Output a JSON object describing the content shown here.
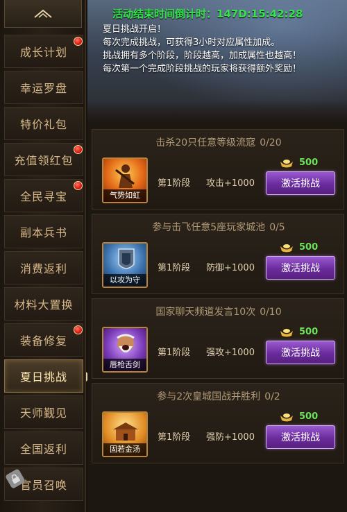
{
  "sidebar": {
    "items": [
      {
        "label": "成长计划",
        "badge": true
      },
      {
        "label": "幸运罗盘",
        "badge": false
      },
      {
        "label": "特价礼包",
        "badge": false
      },
      {
        "label": "充值领红包",
        "badge": true
      },
      {
        "label": "全民寻宝",
        "badge": true
      },
      {
        "label": "副本兵书",
        "badge": false
      },
      {
        "label": "消费返利",
        "badge": false
      },
      {
        "label": "材料大置换",
        "badge": false
      },
      {
        "label": "装备修复",
        "badge": true
      },
      {
        "label": "夏日挑战",
        "badge": false,
        "active": true
      },
      {
        "label": "天师觐见",
        "badge": false
      },
      {
        "label": "全国返利",
        "badge": false
      },
      {
        "label": "官员召唤",
        "badge": false,
        "locked": true
      }
    ]
  },
  "banner": {
    "countdown": "活动结束时间倒计时：147D:15:42:28",
    "lines": [
      "夏日挑战开启！",
      "每次完成挑战，可获得3小时对应属性加成。",
      "挑战拥有多个阶段，阶段越高，加成属性也越高！",
      "每次第一个完成阶段挑战的玩家将获得额外奖励！"
    ]
  },
  "challenges": [
    {
      "title": "击杀20只任意等级流寇",
      "progress": "0/20",
      "icon": "qi-shi-ru-hong",
      "icon_caption": "气势如虹",
      "stage": "第1阶段",
      "attr": "攻击+1000",
      "cost": "500",
      "button": "激活挑战"
    },
    {
      "title": "参与击飞任意5座玩家城池",
      "progress": "0/5",
      "icon": "yi-gong-wei-shou",
      "icon_caption": "以攻为守",
      "stage": "第1阶段",
      "attr": "防御+1000",
      "cost": "500",
      "button": "激活挑战"
    },
    {
      "title": "国家聊天频道发言10次",
      "progress": "0/10",
      "icon": "chun-qiang-she-jian",
      "icon_caption": "唇枪舌剑",
      "stage": "第1阶段",
      "attr": "强攻+1000",
      "cost": "500",
      "button": "激活挑战"
    },
    {
      "title": "参与2次皇城国战并胜利",
      "progress": "0/2",
      "icon": "gu-ruo-jin-tang",
      "icon_caption": "固若金汤",
      "stage": "第1阶段",
      "attr": "强防+1000",
      "cost": "500",
      "button": "激活挑战"
    }
  ],
  "colors": {
    "countdown": "#33e44a",
    "cost": "#6de35c",
    "button": "#6a2b9d",
    "badge": "#d8180e"
  }
}
